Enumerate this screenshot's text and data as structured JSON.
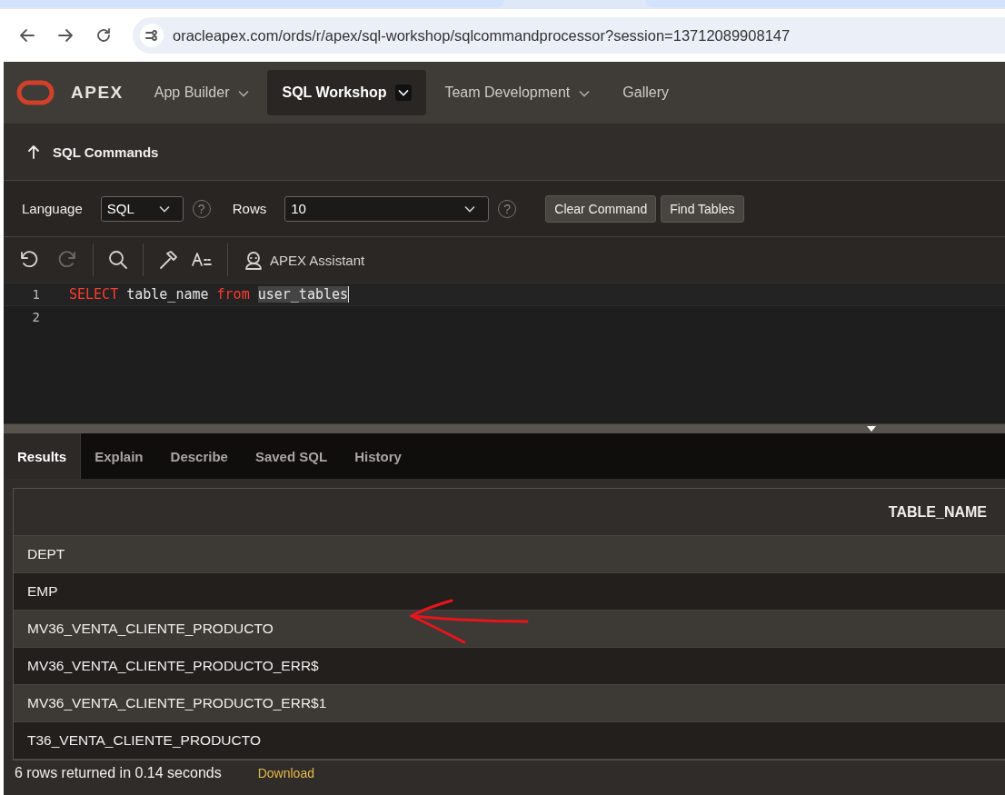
{
  "browser": {
    "url": "oracleapex.com/ords/r/apex/sql-workshop/sqlcommandprocessor?session=13712089908147"
  },
  "app": {
    "logo": "APEX"
  },
  "nav": [
    {
      "label": "App Builder",
      "has_menu": true,
      "selected": false
    },
    {
      "label": "SQL Workshop",
      "has_menu": true,
      "selected": true
    },
    {
      "label": "Team Development",
      "has_menu": true,
      "selected": false
    },
    {
      "label": "Gallery",
      "has_menu": false,
      "selected": false
    }
  ],
  "page_title": "SQL Commands",
  "options": {
    "language_label": "Language",
    "language": "SQL",
    "language_help": "?",
    "rows_label": "Rows",
    "rows": "10",
    "rows_help": "?",
    "buttons": [
      "Clear Command",
      "Find Tables"
    ]
  },
  "toolbar": {
    "undo_disabled": false,
    "redo_disabled": true,
    "assistant": "APEX Assistant"
  },
  "editor": {
    "lines": [
      {
        "number": "1",
        "tokens": [
          {
            "text": "SELECT",
            "kind": "keyword"
          },
          {
            "text": "table_name",
            "kind": "plain"
          },
          {
            "text": "from",
            "kind": "keyword"
          },
          {
            "text": "user_tables",
            "kind": "selection"
          }
        ]
      },
      {
        "number": "2"
      }
    ]
  },
  "result_tabs": [
    {
      "label": "Results",
      "selected": true
    },
    {
      "label": "Explain",
      "selected": false
    },
    {
      "label": "Describe",
      "selected": false
    },
    {
      "label": "Saved SQL",
      "selected": false
    },
    {
      "label": "History",
      "selected": false
    }
  ],
  "table": {
    "columns": [
      "TABLE_NAME"
    ],
    "rows": [
      [
        "DEPT"
      ],
      [
        "EMP"
      ],
      [
        "MV36_VENTA_CLIENTE_PRODUCTO"
      ],
      [
        "MV36_VENTA_CLIENTE_PRODUCTO_ERR$"
      ],
      [
        "MV36_VENTA_CLIENTE_PRODUCTO_ERR$1"
      ],
      [
        "T36_VENTA_CLIENTE_PRODUCTO"
      ]
    ]
  },
  "status": {
    "message": "6 rows returned in 0.14 seconds",
    "download": "Download"
  }
}
